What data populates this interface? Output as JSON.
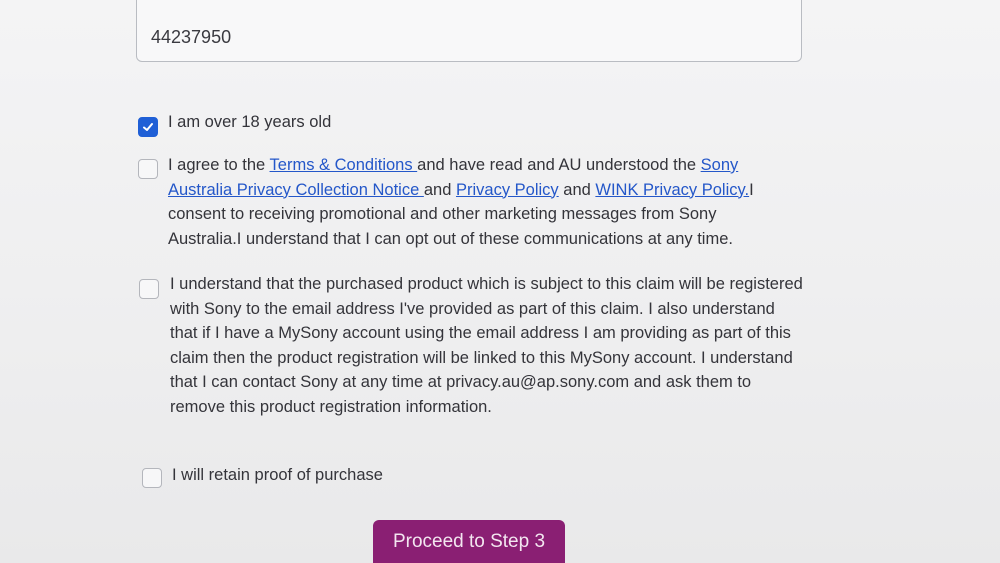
{
  "form": {
    "number_input": {
      "value": "44237950"
    },
    "checkboxes": [
      {
        "checked": true,
        "text": "I am over 18 years old"
      },
      {
        "checked": false,
        "text_1": "I agree to the ",
        "link_terms": "Terms & Conditions ",
        "text_2": "and have read and AU understood the ",
        "link_privacy_notice": "Sony Australia Privacy Collection Notice ",
        "text_3": "and ",
        "link_privacy_policy": "Privacy Policy",
        "text_4": " and ",
        "link_wink": "WINK Privacy Policy.",
        "text_5": "I consent to receiving promotional and other marketing messages from Sony Australia.I understand that I can opt out of these communications at any time."
      },
      {
        "checked": false,
        "text": "I understand that the purchased product which is subject to this claim will be registered with Sony to the email address I've provided as part of this claim. I also understand that if I have a MySony account using the email address I am providing as part of this claim then the product registration will be linked to this MySony account. I understand that I can contact Sony at any time at privacy.au@ap.sony.com and ask them to remove this product registration information."
      },
      {
        "checked": false,
        "text": "I will retain proof of purchase"
      }
    ],
    "proceed_button": "Proceed to Step 3"
  },
  "colors": {
    "accent": "#1f5fd6",
    "link": "#2457c9",
    "button": "#8a1f73"
  },
  "icons": {
    "checkmark": "checkmark-icon"
  }
}
